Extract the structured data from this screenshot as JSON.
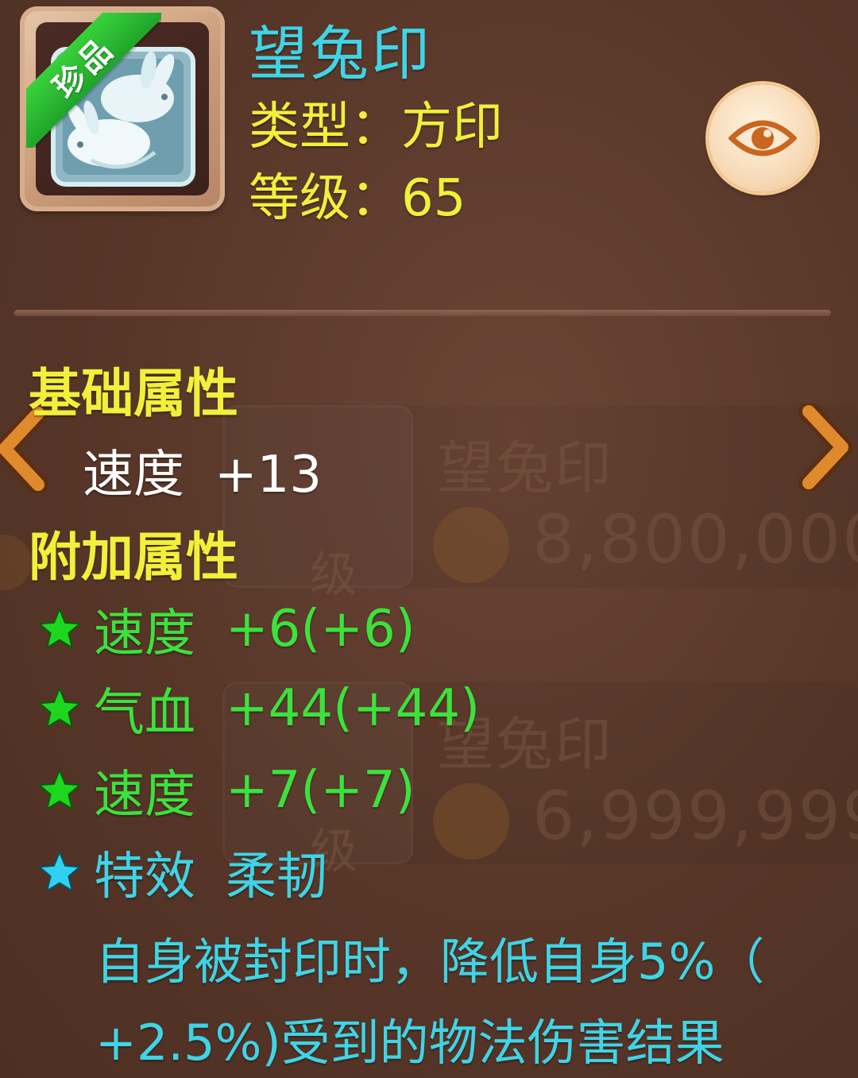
{
  "item": {
    "name": "望兔印",
    "rarity_tag": "珍品",
    "type_line": "类型：方印",
    "level_line": "等级：65",
    "icon": "rabbit-seal-icon"
  },
  "sections": {
    "base_title": "基础属性",
    "extra_title": "附加属性"
  },
  "base_attributes": [
    {
      "name": "速度",
      "value": "+13"
    }
  ],
  "extra_attributes": [
    {
      "name": "速度",
      "value": "+6(+6)",
      "star": "green-star-icon"
    },
    {
      "name": "气血",
      "value": "+44(+44)",
      "star": "green-star-icon"
    },
    {
      "name": "速度",
      "value": "+7(+7)",
      "star": "green-star-icon"
    }
  ],
  "special_effect": {
    "label": "特效",
    "name": "柔韧",
    "star": "cyan-star-icon",
    "description_line1": "自身被封印时，降低自身5%（",
    "description_line2": "+2.5%)受到的物法伤害结果"
  },
  "background_list": [
    {
      "name": "望兔印",
      "price": "8,800,000",
      "level_badge": "级"
    },
    {
      "name": "望兔印",
      "price": "6,999,999",
      "level_badge": "级"
    }
  ],
  "controls": {
    "preview_icon": "eye-icon",
    "prev_icon": "chevron-left-icon",
    "next_icon": "chevron-right-icon"
  },
  "colors": {
    "background": "#5a3a2d",
    "name_cyan": "#3fd4e6",
    "title_yellow": "#f1f03a",
    "attr_green": "#3ce23c",
    "base_white": "#ffffff",
    "rarity_green": "#2fbf32",
    "eye_button": "#f8dcbb",
    "arrow_orange": "#e08a2e"
  }
}
